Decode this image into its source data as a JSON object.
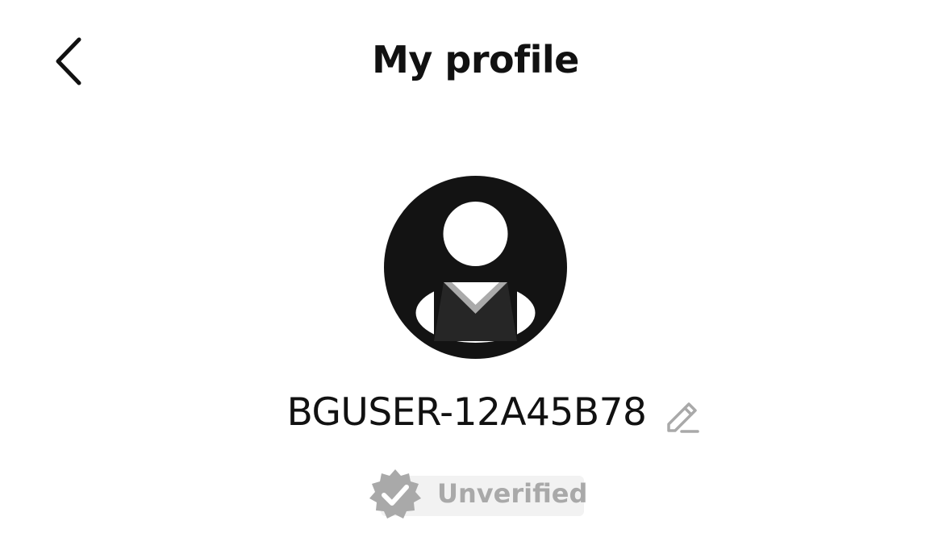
{
  "header": {
    "title": "My profile",
    "back_icon": "chevron-left-icon"
  },
  "profile": {
    "avatar_icon": "default-user-avatar-icon",
    "username": "BGUSER-12A45B78",
    "edit_icon": "pencil-edit-icon"
  },
  "verification": {
    "status_label": "Unverified",
    "badge_icon": "verified-seal-check-icon",
    "text_color": "#a9a9a9",
    "background_color": "#f2f2f2"
  }
}
